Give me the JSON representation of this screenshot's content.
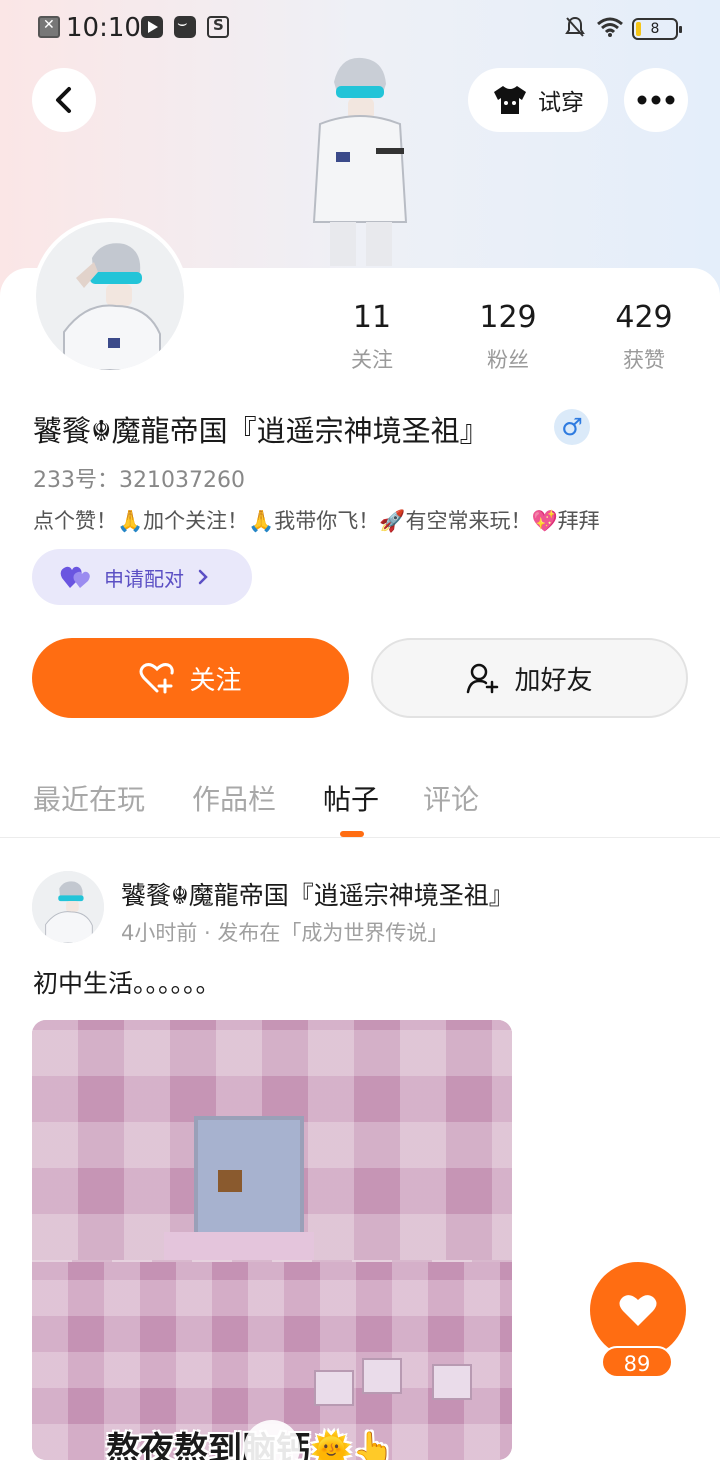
{
  "status_bar": {
    "time": "10:10",
    "battery": "8"
  },
  "header": {
    "tryon_label": "试穿"
  },
  "profile": {
    "stats": [
      {
        "value": "11",
        "label": "关注"
      },
      {
        "value": "129",
        "label": "粉丝"
      },
      {
        "value": "429",
        "label": "获赞"
      }
    ],
    "username": "饕餮☬魔龍帝国『逍遥宗神境圣祖』",
    "gender_symbol": "♂",
    "user_id": "233号：321037260",
    "bio": "点个赞！🙏加个关注！🙏我带你飞！🚀有空常来玩！💖拜拜",
    "match_label": "申请配对",
    "follow_label": "关注",
    "add_friend_label": "加好友"
  },
  "tabs": [
    {
      "label": "最近在玩"
    },
    {
      "label": "作品栏"
    },
    {
      "label": "帖子"
    },
    {
      "label": "评论"
    }
  ],
  "active_tab": "帖子",
  "post": {
    "author": "饕餮☬魔龍帝国『逍遥宗神境圣祖』",
    "meta": "4小时前 · 发布在「成为世界传说」",
    "text": "初中生活。。。。。。",
    "image_caption": "熬夜熬到脑钙🌞👆"
  },
  "like": {
    "count": "89"
  },
  "colors": {
    "accent": "#ff6d12",
    "match_bg": "#e9e8fa",
    "match_text": "#5b4fc4",
    "gender": "#2e7be0"
  }
}
